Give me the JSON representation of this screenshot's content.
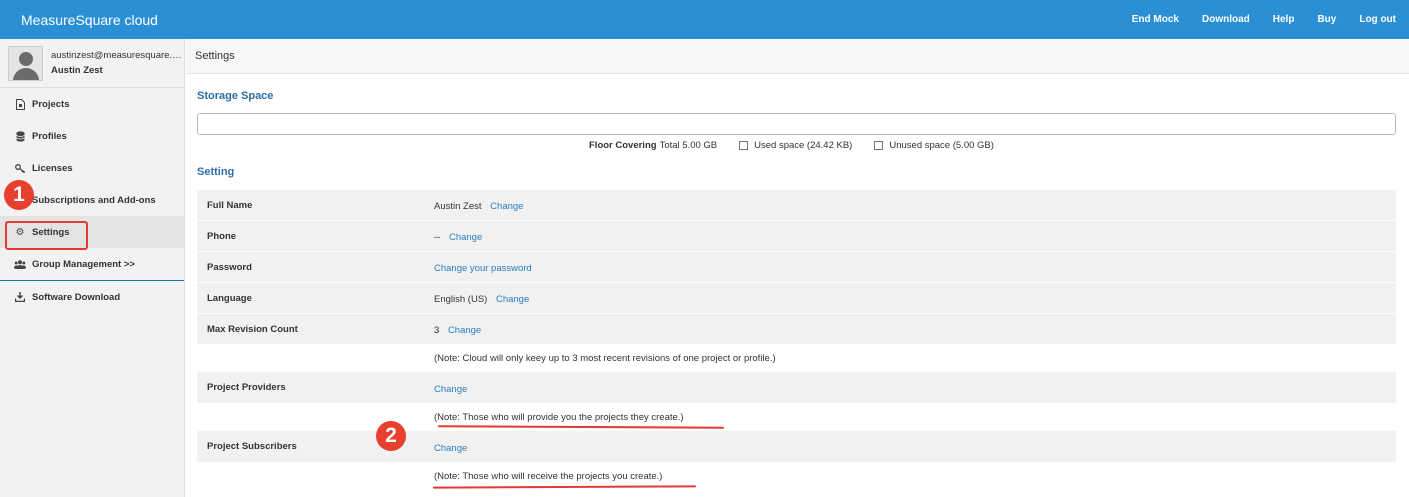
{
  "app": {
    "title": "MeasureSquare cloud"
  },
  "topnav": [
    {
      "label": "End Mock"
    },
    {
      "label": "Download"
    },
    {
      "label": "Help"
    },
    {
      "label": "Buy"
    },
    {
      "label": "Log out"
    }
  ],
  "user": {
    "email": "austinzest@measuresquare.com",
    "name": "Austin Zest"
  },
  "sidebar": {
    "items": [
      {
        "label": "Projects",
        "icon": "file-icon"
      },
      {
        "label": "Profiles",
        "icon": "database-icon"
      },
      {
        "label": "Licenses",
        "icon": "key-icon"
      },
      {
        "label": "Subscriptions and Add-ons",
        "icon": "subscription-icon"
      },
      {
        "label": "Settings",
        "icon": "gear-icon"
      },
      {
        "label": "Group Management >>",
        "icon": "users-icon"
      },
      {
        "label": "Software Download",
        "icon": "download-icon"
      }
    ]
  },
  "annotations": {
    "badge1": "1",
    "badge2": "2",
    "color": "#e53935"
  },
  "breadcrumb": "Settings",
  "storage": {
    "title": "Storage Space",
    "category": "Floor Covering",
    "total": "Total 5.00 GB",
    "used": "Used space (24.42 KB)",
    "unused": "Unused space (5.00 GB)"
  },
  "setting": {
    "title": "Setting",
    "full_name_label": "Full Name",
    "full_name_value": "Austin Zest",
    "phone_label": "Phone",
    "phone_value": "--",
    "password_label": "Password",
    "password_link": "Change your password",
    "language_label": "Language",
    "language_value": "English (US)",
    "max_rev_label": "Max Revision Count",
    "max_rev_value": "3",
    "max_rev_note": "(Note: Cloud will only keey up to 3 most recent revisions of one project or profile.)",
    "providers_label": "Project Providers",
    "providers_note": "(Note: Those who will provide you the projects they create.)",
    "subscribers_label": "Project Subscribers",
    "subscribers_note": "(Note: Those who will receive the projects you create.)",
    "change_label": "Change"
  },
  "colors": {
    "topbar": "#2b8fd6",
    "link": "#2a7ec0",
    "section": "#2d6ea6"
  }
}
